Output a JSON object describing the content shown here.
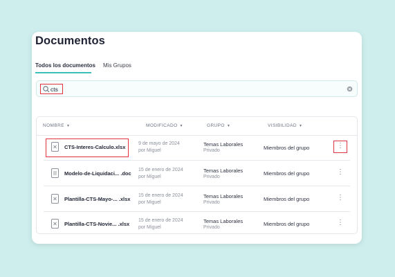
{
  "page": {
    "title": "Documentos"
  },
  "tabs": [
    {
      "label": "Todos los documentos",
      "active": true
    },
    {
      "label": "Mis Grupos",
      "active": false
    }
  ],
  "search": {
    "value": "cts",
    "placeholder": ""
  },
  "table": {
    "columns": [
      "NOMBRE",
      "MODIFICADO",
      "GRUPO",
      "VISIBILIDAD"
    ],
    "rows": [
      {
        "icon": "excel-file-icon",
        "name": "CTS-Interes-Calculo.xlsx",
        "date": "9 de mayo de 2024",
        "by": "por Miguel",
        "group": "Temas Laborales",
        "group_type": "Privado",
        "visibility": "Miembros del grupo",
        "menu": "⋮"
      },
      {
        "icon": "doc-file-icon",
        "name": "Modelo-de-Liquidaci... .doc",
        "date": "15 de enero de 2024",
        "by": "por Miguel",
        "group": "Temas Laborales",
        "group_type": "Privado",
        "visibility": "Miembros del grupo",
        "menu": "⋮"
      },
      {
        "icon": "excel-file-icon",
        "name": "Plantilla-CTS-Mayo-... .xlsx",
        "date": "15 de enero de 2024",
        "by": "por Miguel",
        "group": "Temas Laborales",
        "group_type": "Privado",
        "visibility": "Miembros del grupo",
        "menu": "⋮"
      },
      {
        "icon": "excel-file-icon",
        "name": "Plantilla-CTS-Novie... .xlsx",
        "date": "15 de enero de 2024",
        "by": "por Miguel",
        "group": "Temas Laborales",
        "group_type": "Privado",
        "visibility": "Miembros del grupo",
        "menu": "⋮"
      }
    ]
  },
  "colors": {
    "accent": "#3bbfbb",
    "highlight": "#e0323f",
    "background": "#cdeeed"
  }
}
